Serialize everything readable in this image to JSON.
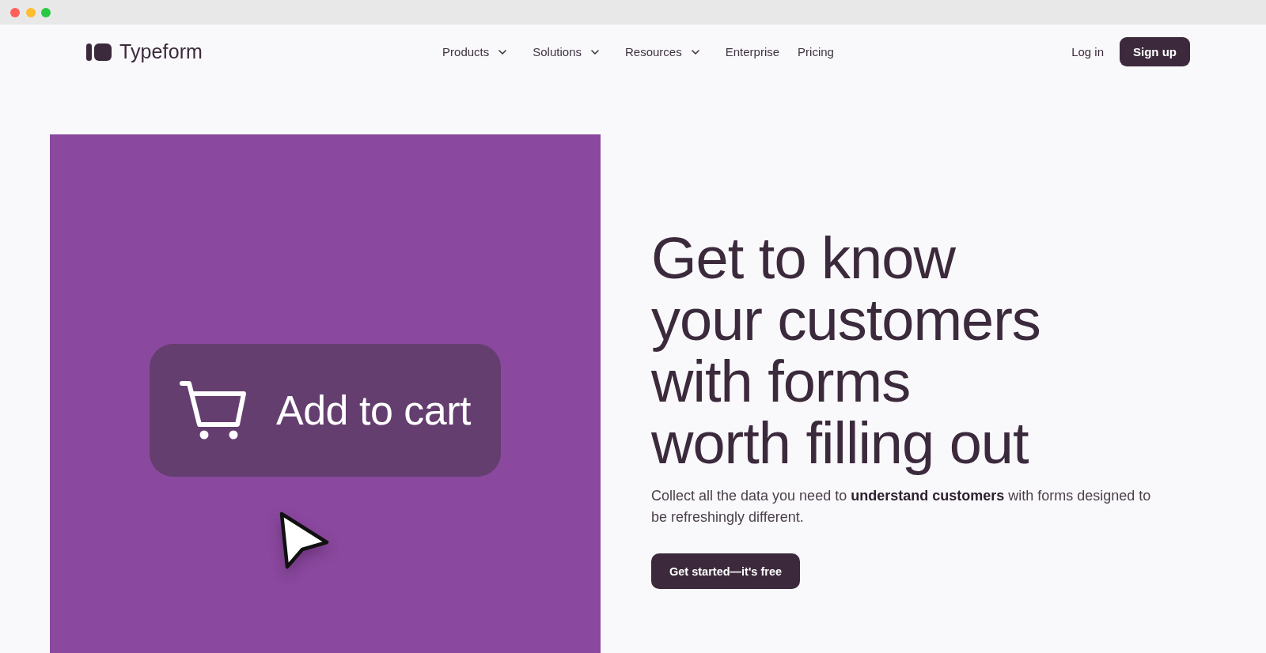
{
  "nav": {
    "brand": "Typeform",
    "menu": [
      {
        "label": "Products",
        "dropdown": true
      },
      {
        "label": "Solutions",
        "dropdown": true
      },
      {
        "label": "Resources",
        "dropdown": true
      },
      {
        "label": "Enterprise",
        "dropdown": false
      },
      {
        "label": "Pricing",
        "dropdown": false
      }
    ],
    "login": "Log in",
    "signup": "Sign up"
  },
  "hero": {
    "illustration": {
      "button_label": "Add to cart"
    },
    "headline": [
      "Get to know",
      "your customers",
      "with forms",
      "worth filling out"
    ],
    "description": "Collect all the data you need to **understand customers** with forms designed to be refreshingly different.",
    "cta": "Get started—it's free"
  }
}
